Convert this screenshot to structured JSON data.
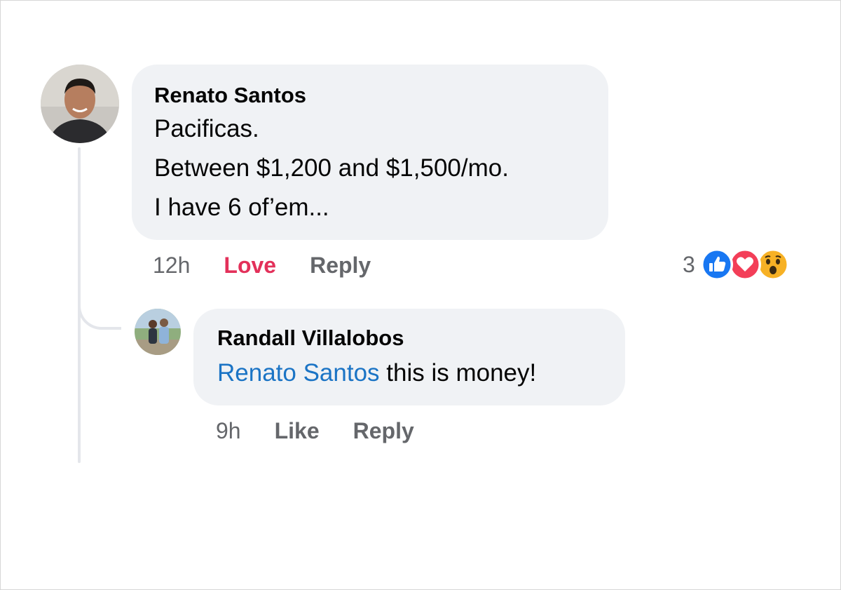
{
  "comments": [
    {
      "author": "Renato Santos",
      "lines": [
        "Pacificas.",
        "Between $1,200 and $1,500/mo.",
        "I have 6 of’em..."
      ],
      "time": "12h",
      "reaction_action": "Love",
      "reply_action": "Reply",
      "reactions": {
        "count": "3",
        "icons": [
          "like-icon",
          "love-icon",
          "wow-icon"
        ]
      },
      "avatar": "avatar-renato"
    }
  ],
  "replies": [
    {
      "author": "Randall Villalobos",
      "mention": "Renato Santos",
      "text": " this is money!",
      "time": "9h",
      "reaction_action": "Like",
      "reply_action": "Reply",
      "avatar": "avatar-randall"
    }
  ],
  "colors": {
    "bubble": "#f0f2f5",
    "mention": "#1b74c5",
    "love": "#e3305a",
    "muted": "#65676b",
    "like_blue": "#1877f2",
    "love_red": "#f33e58",
    "wow_yellow": "#f7b125"
  }
}
